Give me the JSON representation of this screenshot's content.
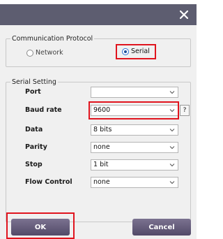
{
  "window": {
    "close_icon": "close-icon",
    "titlebar_color": "#5d5d70"
  },
  "protocol": {
    "legend": "Communication Protocol",
    "options": [
      {
        "label": "Network",
        "selected": false
      },
      {
        "label": "Serial",
        "selected": true
      }
    ]
  },
  "serial": {
    "legend": "Serial Setting",
    "fields": [
      {
        "label": "Port",
        "value": ""
      },
      {
        "label": "Baud rate",
        "value": "9600"
      },
      {
        "label": "Data",
        "value": "8 bits"
      },
      {
        "label": "Parity",
        "value": "none"
      },
      {
        "label": "Stop",
        "value": "1 bit"
      },
      {
        "label": "Flow Control",
        "value": "none"
      }
    ],
    "help_label": "?"
  },
  "buttons": {
    "ok": "OK",
    "cancel": "Cancel"
  },
  "colors": {
    "highlight": "#e0141e",
    "button": "#5f5778"
  }
}
